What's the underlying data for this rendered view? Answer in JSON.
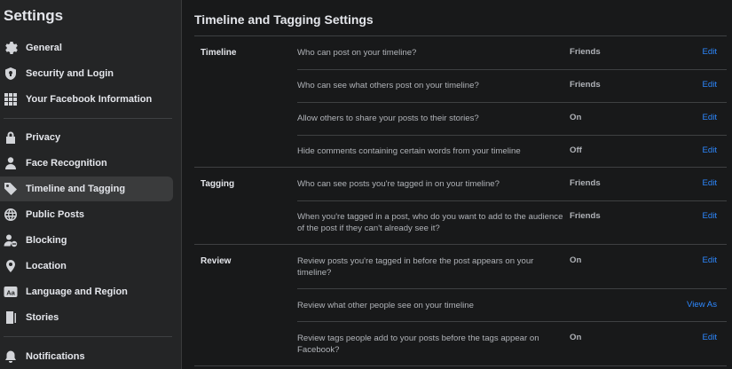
{
  "sidebar": {
    "title": "Settings",
    "items": [
      {
        "label": "General",
        "icon": "gear-icon"
      },
      {
        "label": "Security and Login",
        "icon": "shield-icon"
      },
      {
        "label": "Your Facebook Information",
        "icon": "grid-icon"
      },
      {
        "label": "Privacy",
        "icon": "lock-icon"
      },
      {
        "label": "Face Recognition",
        "icon": "person-icon"
      },
      {
        "label": "Timeline and Tagging",
        "icon": "tag-icon",
        "active": true
      },
      {
        "label": "Public Posts",
        "icon": "globe-icon"
      },
      {
        "label": "Blocking",
        "icon": "block-user-icon"
      },
      {
        "label": "Location",
        "icon": "location-pin-icon"
      },
      {
        "label": "Language and Region",
        "icon": "language-icon"
      },
      {
        "label": "Stories",
        "icon": "book-icon"
      },
      {
        "label": "Notifications",
        "icon": "bell-icon"
      }
    ]
  },
  "main": {
    "title": "Timeline and Tagging Settings",
    "sections": [
      {
        "label": "Timeline",
        "rows": [
          {
            "text": "Who can post on your timeline?",
            "value": "Friends",
            "action": "Edit"
          },
          {
            "text": "Who can see what others post on your timeline?",
            "value": "Friends",
            "action": "Edit"
          },
          {
            "text": "Allow others to share your posts to their stories?",
            "value": "On",
            "action": "Edit"
          },
          {
            "text": "Hide comments containing certain words from your timeline",
            "value": "Off",
            "action": "Edit"
          }
        ]
      },
      {
        "label": "Tagging",
        "rows": [
          {
            "text": "Who can see posts you're tagged in on your timeline?",
            "value": "Friends",
            "action": "Edit"
          },
          {
            "text": "When you're tagged in a post, who do you want to add to the audience of the post if they can't already see it?",
            "value": "Friends",
            "action": "Edit"
          }
        ]
      },
      {
        "label": "Review",
        "rows": [
          {
            "text": "Review posts you're tagged in before the post appears on your timeline?",
            "value": "On",
            "action": "Edit"
          },
          {
            "text": "Review what other people see on your timeline",
            "value": "",
            "action": "View As"
          },
          {
            "text": "Review tags people add to your posts before the tags appear on Facebook?",
            "value": "On",
            "action": "Edit"
          }
        ]
      }
    ]
  }
}
